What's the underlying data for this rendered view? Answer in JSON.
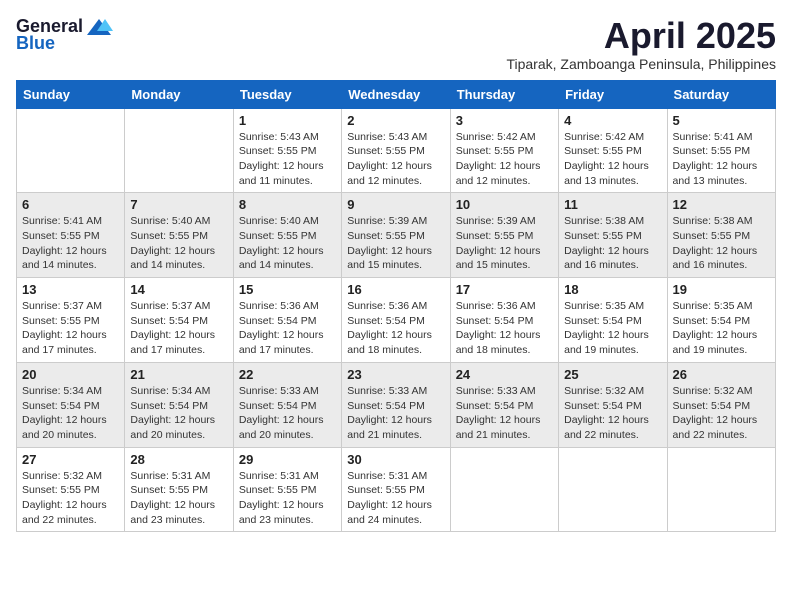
{
  "header": {
    "logo_general": "General",
    "logo_blue": "Blue",
    "month_title": "April 2025",
    "location": "Tiparak, Zamboanga Peninsula, Philippines"
  },
  "weekdays": [
    "Sunday",
    "Monday",
    "Tuesday",
    "Wednesday",
    "Thursday",
    "Friday",
    "Saturday"
  ],
  "weeks": [
    [
      {
        "day": "",
        "info": ""
      },
      {
        "day": "",
        "info": ""
      },
      {
        "day": "1",
        "info": "Sunrise: 5:43 AM\nSunset: 5:55 PM\nDaylight: 12 hours\nand 11 minutes."
      },
      {
        "day": "2",
        "info": "Sunrise: 5:43 AM\nSunset: 5:55 PM\nDaylight: 12 hours\nand 12 minutes."
      },
      {
        "day": "3",
        "info": "Sunrise: 5:42 AM\nSunset: 5:55 PM\nDaylight: 12 hours\nand 12 minutes."
      },
      {
        "day": "4",
        "info": "Sunrise: 5:42 AM\nSunset: 5:55 PM\nDaylight: 12 hours\nand 13 minutes."
      },
      {
        "day": "5",
        "info": "Sunrise: 5:41 AM\nSunset: 5:55 PM\nDaylight: 12 hours\nand 13 minutes."
      }
    ],
    [
      {
        "day": "6",
        "info": "Sunrise: 5:41 AM\nSunset: 5:55 PM\nDaylight: 12 hours\nand 14 minutes."
      },
      {
        "day": "7",
        "info": "Sunrise: 5:40 AM\nSunset: 5:55 PM\nDaylight: 12 hours\nand 14 minutes."
      },
      {
        "day": "8",
        "info": "Sunrise: 5:40 AM\nSunset: 5:55 PM\nDaylight: 12 hours\nand 14 minutes."
      },
      {
        "day": "9",
        "info": "Sunrise: 5:39 AM\nSunset: 5:55 PM\nDaylight: 12 hours\nand 15 minutes."
      },
      {
        "day": "10",
        "info": "Sunrise: 5:39 AM\nSunset: 5:55 PM\nDaylight: 12 hours\nand 15 minutes."
      },
      {
        "day": "11",
        "info": "Sunrise: 5:38 AM\nSunset: 5:55 PM\nDaylight: 12 hours\nand 16 minutes."
      },
      {
        "day": "12",
        "info": "Sunrise: 5:38 AM\nSunset: 5:55 PM\nDaylight: 12 hours\nand 16 minutes."
      }
    ],
    [
      {
        "day": "13",
        "info": "Sunrise: 5:37 AM\nSunset: 5:55 PM\nDaylight: 12 hours\nand 17 minutes."
      },
      {
        "day": "14",
        "info": "Sunrise: 5:37 AM\nSunset: 5:54 PM\nDaylight: 12 hours\nand 17 minutes."
      },
      {
        "day": "15",
        "info": "Sunrise: 5:36 AM\nSunset: 5:54 PM\nDaylight: 12 hours\nand 17 minutes."
      },
      {
        "day": "16",
        "info": "Sunrise: 5:36 AM\nSunset: 5:54 PM\nDaylight: 12 hours\nand 18 minutes."
      },
      {
        "day": "17",
        "info": "Sunrise: 5:36 AM\nSunset: 5:54 PM\nDaylight: 12 hours\nand 18 minutes."
      },
      {
        "day": "18",
        "info": "Sunrise: 5:35 AM\nSunset: 5:54 PM\nDaylight: 12 hours\nand 19 minutes."
      },
      {
        "day": "19",
        "info": "Sunrise: 5:35 AM\nSunset: 5:54 PM\nDaylight: 12 hours\nand 19 minutes."
      }
    ],
    [
      {
        "day": "20",
        "info": "Sunrise: 5:34 AM\nSunset: 5:54 PM\nDaylight: 12 hours\nand 20 minutes."
      },
      {
        "day": "21",
        "info": "Sunrise: 5:34 AM\nSunset: 5:54 PM\nDaylight: 12 hours\nand 20 minutes."
      },
      {
        "day": "22",
        "info": "Sunrise: 5:33 AM\nSunset: 5:54 PM\nDaylight: 12 hours\nand 20 minutes."
      },
      {
        "day": "23",
        "info": "Sunrise: 5:33 AM\nSunset: 5:54 PM\nDaylight: 12 hours\nand 21 minutes."
      },
      {
        "day": "24",
        "info": "Sunrise: 5:33 AM\nSunset: 5:54 PM\nDaylight: 12 hours\nand 21 minutes."
      },
      {
        "day": "25",
        "info": "Sunrise: 5:32 AM\nSunset: 5:54 PM\nDaylight: 12 hours\nand 22 minutes."
      },
      {
        "day": "26",
        "info": "Sunrise: 5:32 AM\nSunset: 5:54 PM\nDaylight: 12 hours\nand 22 minutes."
      }
    ],
    [
      {
        "day": "27",
        "info": "Sunrise: 5:32 AM\nSunset: 5:55 PM\nDaylight: 12 hours\nand 22 minutes."
      },
      {
        "day": "28",
        "info": "Sunrise: 5:31 AM\nSunset: 5:55 PM\nDaylight: 12 hours\nand 23 minutes."
      },
      {
        "day": "29",
        "info": "Sunrise: 5:31 AM\nSunset: 5:55 PM\nDaylight: 12 hours\nand 23 minutes."
      },
      {
        "day": "30",
        "info": "Sunrise: 5:31 AM\nSunset: 5:55 PM\nDaylight: 12 hours\nand 24 minutes."
      },
      {
        "day": "",
        "info": ""
      },
      {
        "day": "",
        "info": ""
      },
      {
        "day": "",
        "info": ""
      }
    ]
  ]
}
